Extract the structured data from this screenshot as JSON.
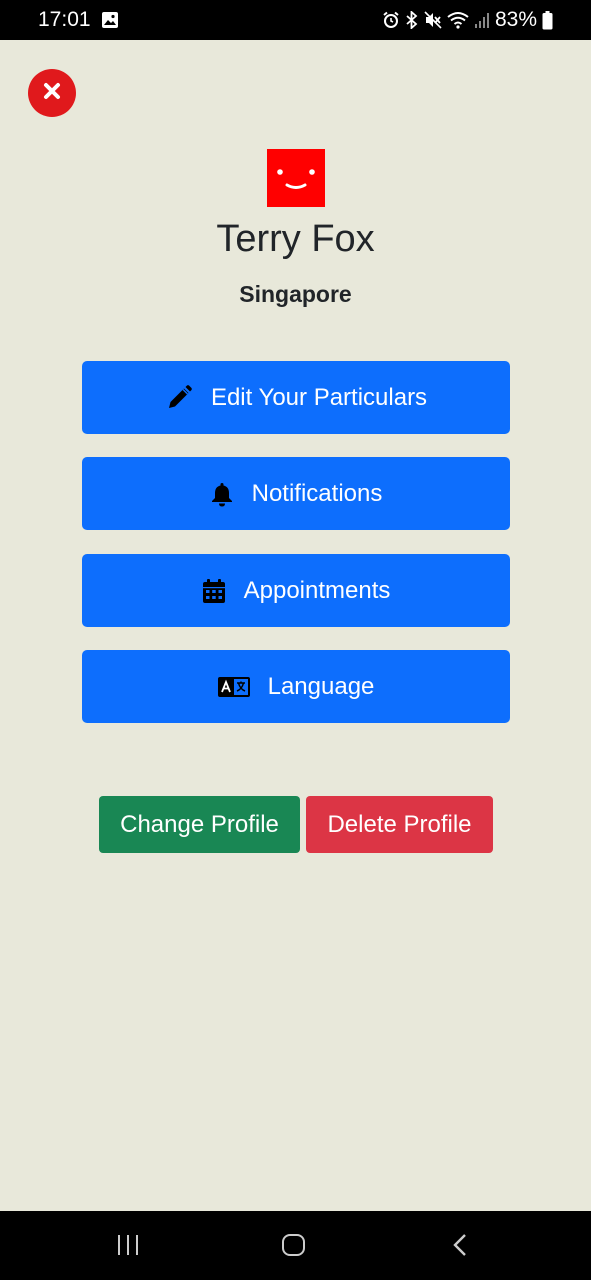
{
  "status_bar": {
    "time": "17:01",
    "battery": "83%"
  },
  "profile": {
    "name": "Terry Fox",
    "location": "Singapore"
  },
  "menu": [
    {
      "label": "Edit Your Particulars",
      "icon": "pencil-icon"
    },
    {
      "label": "Notifications",
      "icon": "bell-icon"
    },
    {
      "label": "Appointments",
      "icon": "calendar-icon"
    },
    {
      "label": "Language",
      "icon": "language-icon"
    }
  ],
  "actions": {
    "change_profile": "Change Profile",
    "delete_profile": "Delete Profile"
  },
  "colors": {
    "background": "#e8e8da",
    "primary": "#0d6efd",
    "success": "#198754",
    "danger": "#dc3545",
    "close": "#e0191c",
    "avatar": "#ff0000"
  }
}
